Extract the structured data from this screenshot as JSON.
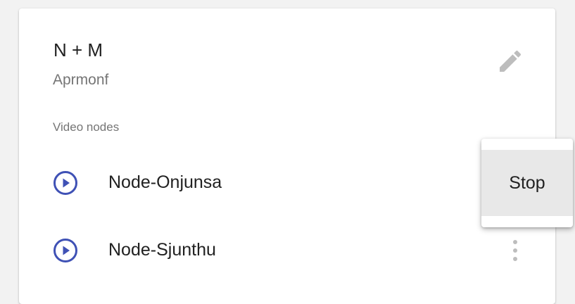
{
  "card": {
    "title": "N + M",
    "subtitle": "Aprmonf",
    "edit_icon": "pencil-icon"
  },
  "section": {
    "label": "Video nodes"
  },
  "nodes": [
    {
      "name": "Node-Onjunsa",
      "icon": "play-circle-icon"
    },
    {
      "name": "Node-Sjunthu",
      "icon": "play-circle-icon"
    }
  ],
  "menu": {
    "items": [
      {
        "label": "Stop"
      }
    ]
  },
  "colors": {
    "accent": "#3f51b5",
    "icon_grey": "#bdbdbd",
    "menu_highlight": "#e8e8e8"
  }
}
